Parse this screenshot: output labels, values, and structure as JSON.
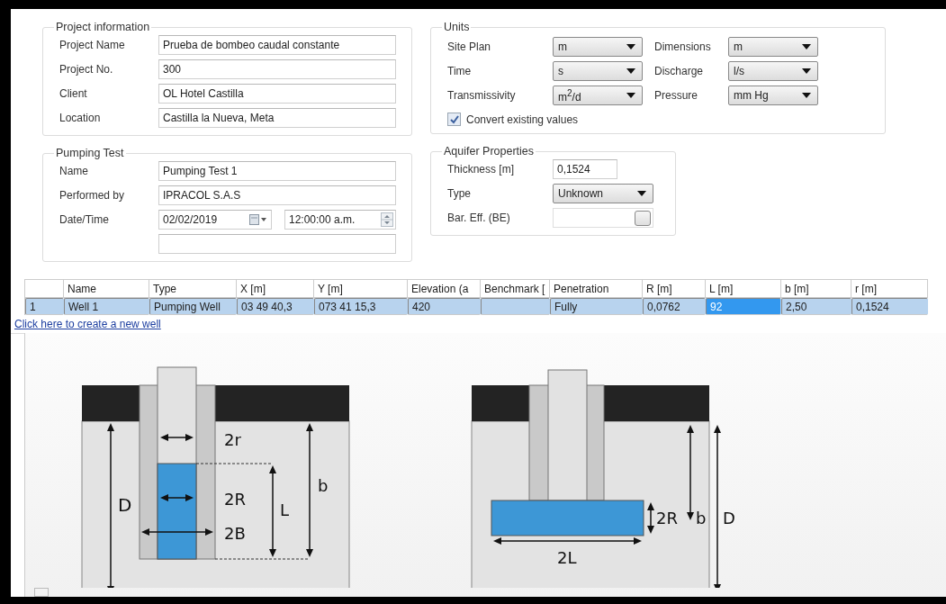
{
  "project_information": {
    "title": "Project information",
    "fields": [
      {
        "label": "Project Name",
        "value": "Prueba de bombeo caudal constante"
      },
      {
        "label": "Project No.",
        "value": "300"
      },
      {
        "label": "Client",
        "value": "OL Hotel Castilla"
      },
      {
        "label": "Location",
        "value": "Castilla la Nueva, Meta"
      }
    ]
  },
  "pumping_test": {
    "title": "Pumping Test",
    "fields": [
      {
        "kind": "text",
        "label": "Name",
        "value": "Pumping Test 1"
      },
      {
        "kind": "text",
        "label": "Performed by",
        "value": "IPRACOL S.A.S"
      },
      {
        "kind": "datetime",
        "label": "Date/Time",
        "date": "02/02/2019",
        "time": "12:00:00 a.m."
      },
      {
        "kind": "empty"
      }
    ]
  },
  "units": {
    "title": "Units",
    "selects": [
      {
        "label": "Site Plan",
        "value": "m"
      },
      {
        "label": "Dimensions",
        "value": "m"
      },
      {
        "label": "Time",
        "value": "s"
      },
      {
        "label": "Discharge",
        "value": "l/s"
      },
      {
        "label": "Transmissivity",
        "value": "m$^{2}$/d"
      },
      {
        "label": "Pressure",
        "value": "mm Hg"
      }
    ],
    "convert": {
      "label": "Convert existing values",
      "checked": true
    }
  },
  "aquifer_properties": {
    "title": "Aquifer Properties",
    "fields": [
      {
        "kind": "text",
        "label": "Thickness [m]",
        "value": "0,1524"
      },
      {
        "kind": "select",
        "label": "Type",
        "value": "Unknown"
      },
      {
        "kind": "button_field",
        "label": "Bar. Eff. (BE)"
      }
    ]
  },
  "wells_table": {
    "columns": [
      "Name",
      "Type",
      "X [m]",
      "Y [m]",
      "Elevation (a",
      "Benchmark [",
      "Penetration",
      "R [m]",
      "L [m]",
      "b [m]",
      "r [m]"
    ],
    "rows": [
      {
        "number": "1",
        "selected": true,
        "cells": [
          {
            "text": "Well 1",
            "focused": false
          },
          {
            "text": "Pumping Well",
            "focused": false
          },
          {
            "text": "03 49 40,3",
            "focused": false
          },
          {
            "text": "073 41 15,3",
            "focused": false
          },
          {
            "text": "420",
            "focused": false
          },
          {
            "text": null,
            "focused": false
          },
          {
            "text": "Fully",
            "focused": false
          },
          {
            "text": "0,0762",
            "focused": false
          },
          {
            "text": "92",
            "focused": true
          },
          {
            "text": "2,50",
            "focused": false
          },
          {
            "text": "0,1524",
            "focused": false
          }
        ]
      }
    ],
    "new_well_link": "Click here to create a new well"
  },
  "diagrams": [
    {
      "kind": "vertical_well",
      "labels": {
        "casing_diameter": "2r",
        "screen_diameter": "2R",
        "borehole_diameter": "2B",
        "depth": "D",
        "screen_length": "L",
        "thickness": "b"
      }
    },
    {
      "kind": "horizontal_well",
      "labels": {
        "screen_diameter": "2R",
        "thickness": "b",
        "depth": "D",
        "screen_length": "2L"
      }
    }
  ]
}
